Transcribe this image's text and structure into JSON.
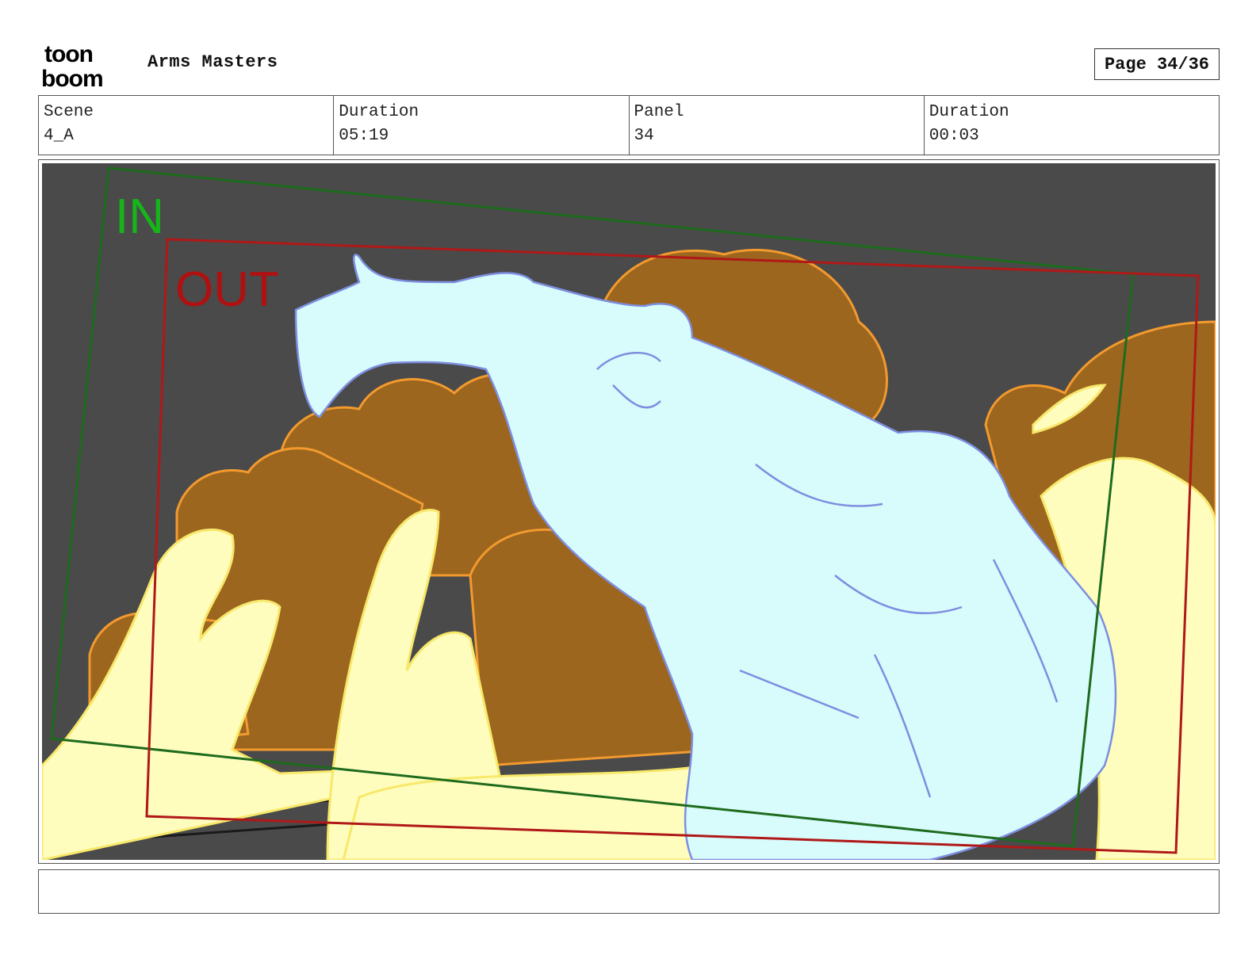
{
  "header": {
    "logo_text_top": "toon",
    "logo_text_bottom": "boom",
    "project_title": "Arms Masters",
    "page_label": "Page 34/36"
  },
  "info": [
    {
      "label": "Scene",
      "value": "4_A"
    },
    {
      "label": "Duration",
      "value": "05:19"
    },
    {
      "label": "Panel",
      "value": "34"
    },
    {
      "label": "Duration",
      "value": "00:03"
    }
  ],
  "panel": {
    "in_label": "IN",
    "out_label": "OUT",
    "colors": {
      "background": "#4a4a4a",
      "smoke_dark": "#9c661f",
      "smoke_outline": "#f39a2e",
      "fire_light": "#fffdbd",
      "character_fill": "#d8fbfb",
      "character_line": "#7d8ee0",
      "in_frame": "#1e6b1e",
      "out_frame": "#b01818"
    }
  },
  "notes": {
    "text": ""
  }
}
